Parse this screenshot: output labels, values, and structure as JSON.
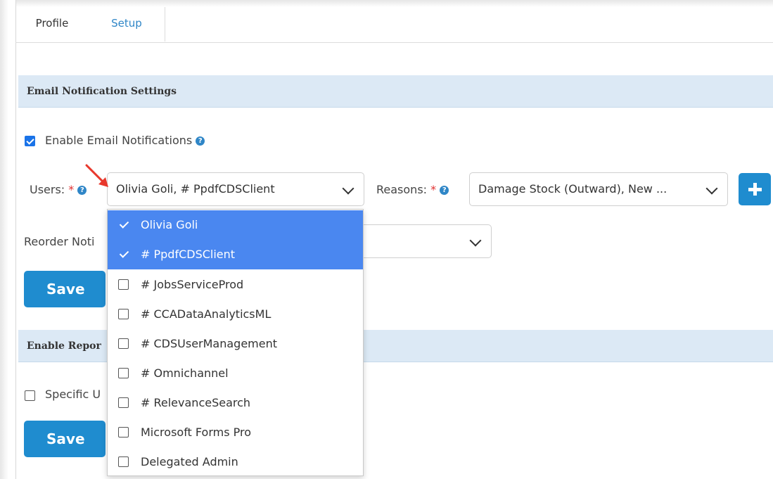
{
  "tabs": [
    {
      "label": "Profile",
      "active": false
    },
    {
      "label": "Setup",
      "active": true
    }
  ],
  "email_section": {
    "title": "Email Notification Settings",
    "enable_label": "Enable Email Notifications",
    "enable_checked": true,
    "users_label": "Users:",
    "users_value": "Olivia Goli, # PpdfCDSClient",
    "reasons_label": "Reasons:",
    "reasons_value": "Damage Stock (Outward), New ...",
    "reorder_label": "Reorder Noti",
    "save_label": "Save"
  },
  "report_section": {
    "title": "Enable Repor",
    "specific_label": "Specific U",
    "specific_checked": false,
    "save_label": "Save"
  },
  "required_mark": "*",
  "help_glyph": "?",
  "users_dropdown": {
    "options": [
      {
        "label": "Olivia Goli",
        "checked": true
      },
      {
        "label": "# PpdfCDSClient",
        "checked": true
      },
      {
        "label": "# JobsServiceProd",
        "checked": false
      },
      {
        "label": "# CCADataAnalyticsML",
        "checked": false
      },
      {
        "label": "# CDSUserManagement",
        "checked": false
      },
      {
        "label": "# Omnichannel",
        "checked": false
      },
      {
        "label": "# RelevanceSearch",
        "checked": false
      },
      {
        "label": "Microsoft Forms Pro",
        "checked": false
      },
      {
        "label": "Delegated Admin",
        "checked": false
      }
    ]
  },
  "colors": {
    "accent": "#1f8ccf",
    "selected_option": "#4a87f0",
    "section_header_bg": "#dce9f5",
    "required": "#e03030",
    "annotation_arrow": "#e8382c"
  }
}
